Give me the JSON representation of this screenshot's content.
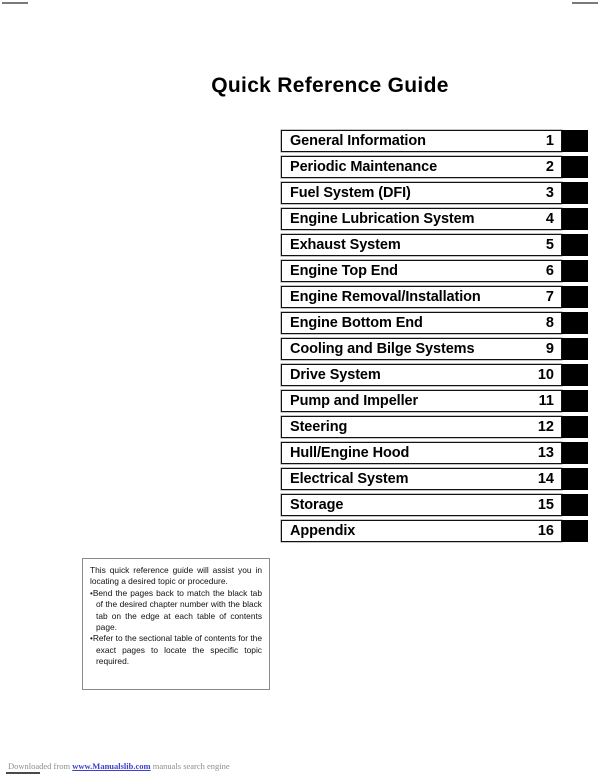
{
  "page": {
    "title": "Quick Reference Guide"
  },
  "chapters": [
    {
      "label": "General Information",
      "number": "1"
    },
    {
      "label": "Periodic Maintenance",
      "number": "2"
    },
    {
      "label": "Fuel System (DFI)",
      "number": "3"
    },
    {
      "label": "Engine Lubrication System",
      "number": "4"
    },
    {
      "label": "Exhaust System",
      "number": "5"
    },
    {
      "label": "Engine Top End",
      "number": "6"
    },
    {
      "label": "Engine Removal/Installation",
      "number": "7"
    },
    {
      "label": "Engine Bottom End",
      "number": "8"
    },
    {
      "label": "Cooling and Bilge Systems",
      "number": "9"
    },
    {
      "label": "Drive System",
      "number": "10"
    },
    {
      "label": "Pump and Impeller",
      "number": "11"
    },
    {
      "label": "Steering",
      "number": "12"
    },
    {
      "label": "Hull/Engine Hood",
      "number": "13"
    },
    {
      "label": "Electrical System",
      "number": "14"
    },
    {
      "label": "Storage",
      "number": "15"
    },
    {
      "label": "Appendix",
      "number": "16"
    }
  ],
  "note": {
    "intro": "This quick reference guide will assist you in locating a desired topic or procedure.",
    "bullets": [
      "Bend the pages back to match the black tab of the desired chapter number with the black tab on the edge at each table of contents page.",
      "Refer to the sectional table of contents for the exact pages to locate the specific topic required."
    ],
    "bullet_glyph": "•"
  },
  "footer": {
    "prefix": "Downloaded from ",
    "link": "www.Manualslib.com",
    "suffix": " manuals search engine"
  },
  "colors": {
    "tab_black": "#000000",
    "link_blue": "#4040cf",
    "footer_gray": "#8d8d8d",
    "note_border": "#8a8a8a"
  }
}
